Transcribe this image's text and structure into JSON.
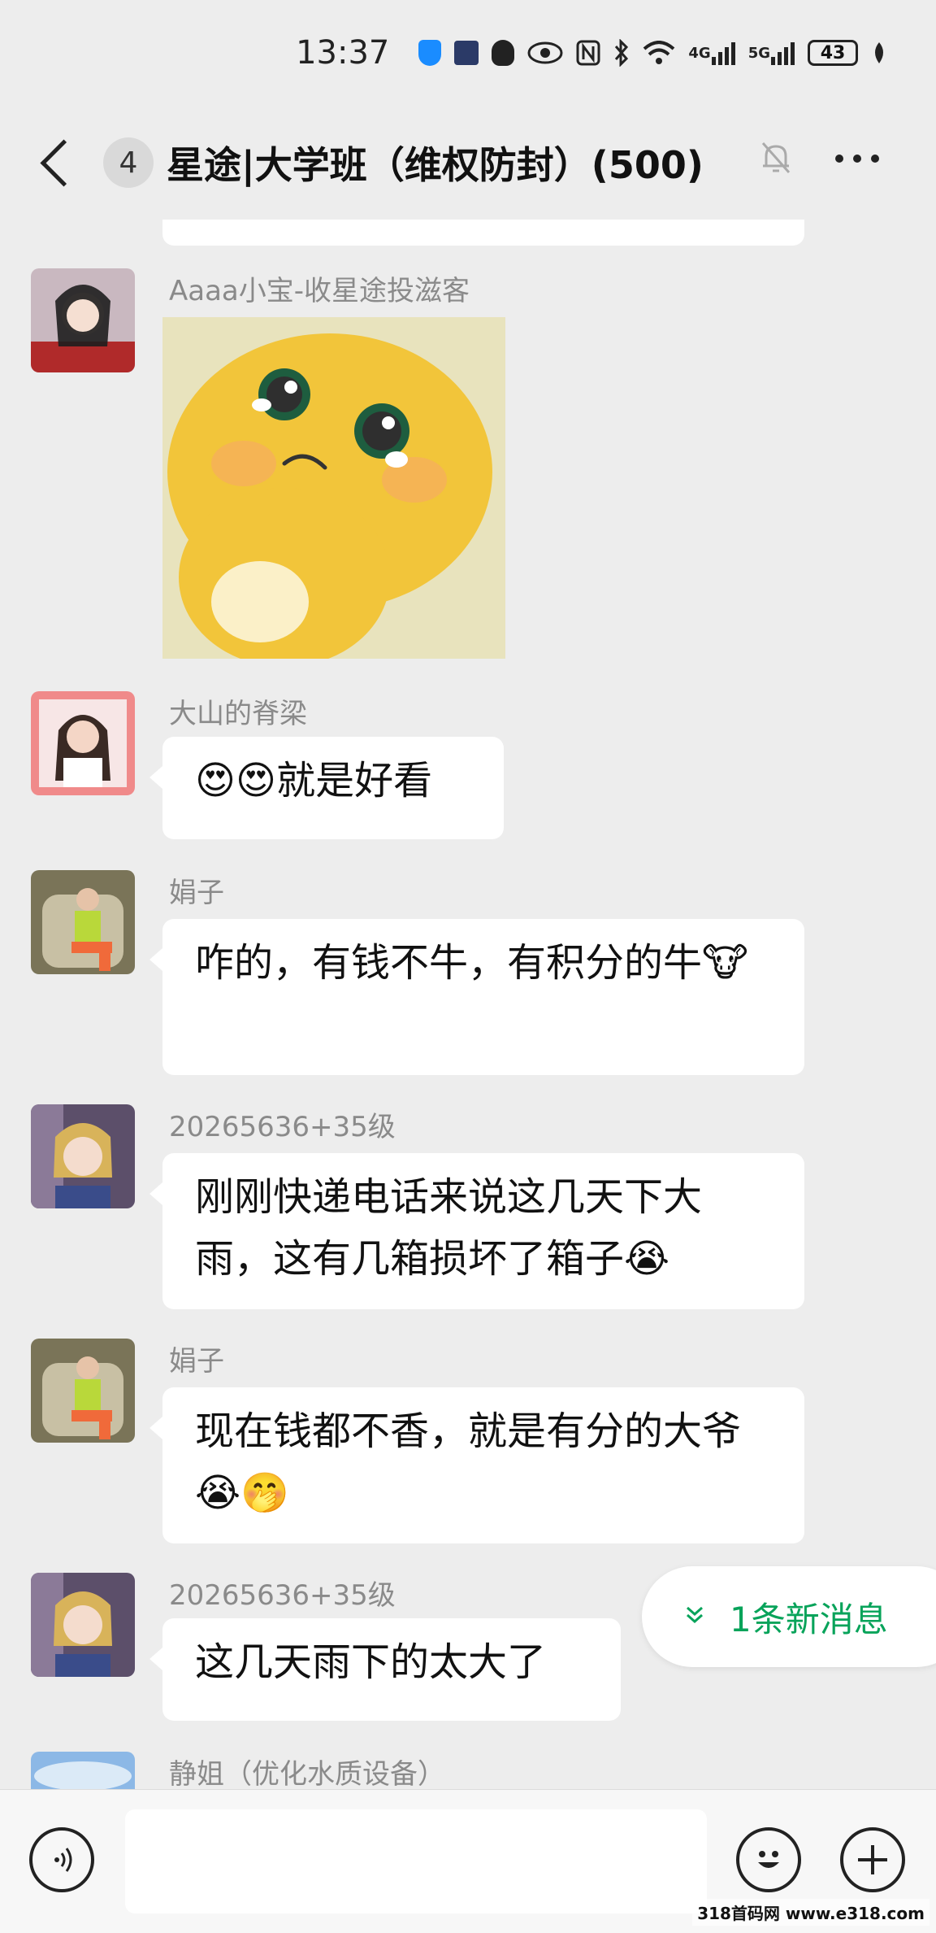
{
  "status_bar": {
    "time": "13:37",
    "network_1": "4G",
    "network_2": "5G",
    "battery": "43"
  },
  "header": {
    "unread_count": "4",
    "title": "星途|大学班（维权防封）(500)"
  },
  "messages": [
    {
      "sender": "Aaaa小宝-收星途投滋客",
      "type": "sticker",
      "sticker_desc": "crying-yellow-character-sticker"
    },
    {
      "sender": "大山的脊梁",
      "text": "😍😍就是好看"
    },
    {
      "sender": "娟子",
      "text": "咋的，有钱不牛，有积分的牛🐮"
    },
    {
      "sender": "20265636+35级",
      "text": "刚刚快递电话来说这几天下大雨，这有几箱损坏了箱子😭"
    },
    {
      "sender": "娟子",
      "text": "现在钱都不香，就是有分的大爷😭🤭"
    },
    {
      "sender": "20265636+35级",
      "text": "这几天雨下的太大了"
    },
    {
      "sender": "静姐（优化水质设备）"
    }
  ],
  "new_messages_pill": {
    "text": "1条新消息"
  },
  "watermark": "318首码网 www.e318.com",
  "colors": {
    "background": "#ededed",
    "bubble": "#ffffff",
    "accent_green": "#07a35a"
  }
}
